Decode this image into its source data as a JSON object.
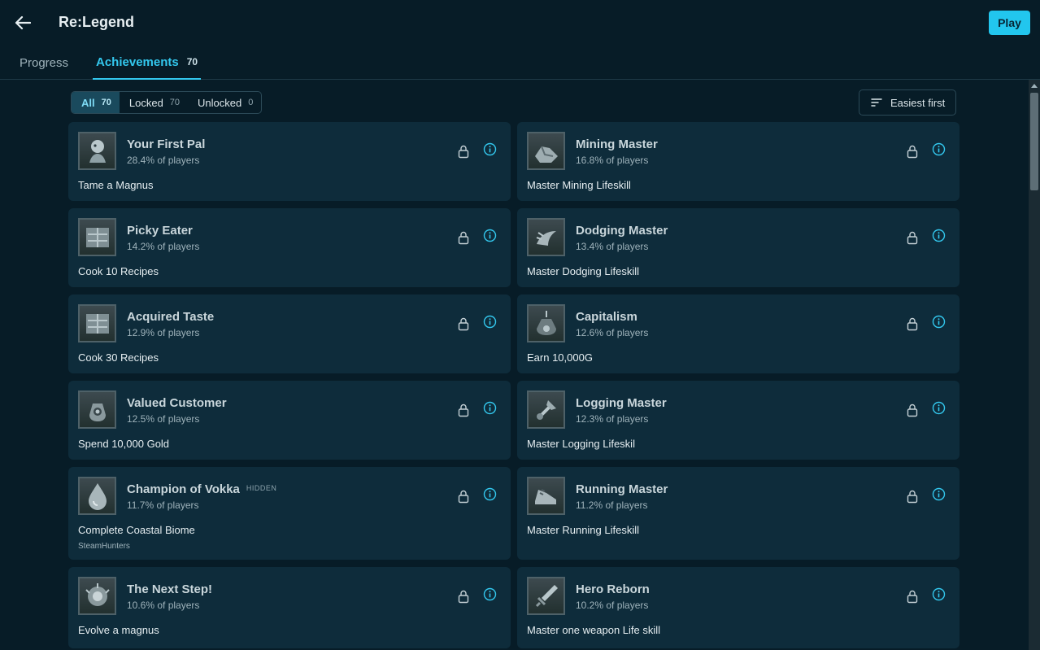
{
  "header": {
    "title": "Re:Legend",
    "play_label": "Play"
  },
  "tabs": {
    "progress_label": "Progress",
    "achievements_label": "Achievements",
    "achievements_count": "70"
  },
  "filters": {
    "all_label": "All",
    "all_count": "70",
    "locked_label": "Locked",
    "locked_count": "70",
    "unlocked_label": "Unlocked",
    "unlocked_count": "0"
  },
  "sort": {
    "label": "Easiest first"
  },
  "colors": {
    "accent": "#22c6ee",
    "background": "#071c27",
    "card": "#0e2c3b"
  },
  "achievements": [
    {
      "name": "Your First Pal",
      "percent": "28.4% of players",
      "description": "Tame a Magnus",
      "icon": "pal-icon"
    },
    {
      "name": "Mining Master",
      "percent": "16.8% of players",
      "description": "Master Mining Lifeskill",
      "icon": "ore-icon"
    },
    {
      "name": "Picky Eater",
      "percent": "14.2% of players",
      "description": "Cook 10 Recipes",
      "icon": "kitchen-icon"
    },
    {
      "name": "Dodging Master",
      "percent": "13.4% of players",
      "description": "Master Dodging Lifeskill",
      "icon": "dodge-icon"
    },
    {
      "name": "Acquired Taste",
      "percent": "12.9% of players",
      "description": "Cook 30 Recipes",
      "icon": "kitchen-icon"
    },
    {
      "name": "Capitalism",
      "percent": "12.6% of players",
      "description": "Earn 10,000G",
      "icon": "money-bag-icon"
    },
    {
      "name": "Valued Customer",
      "percent": "12.5% of players",
      "description": "Spend 10,000 Gold",
      "icon": "coin-bag-icon"
    },
    {
      "name": "Logging Master",
      "percent": "12.3% of players",
      "description": "Master Logging Lifeskil",
      "icon": "axe-icon"
    },
    {
      "name": "Champion of Vokka",
      "percent": "11.7% of players",
      "description": "Complete Coastal Biome",
      "hidden_label": "HIDDEN",
      "source": "SteamHunters",
      "icon": "water-drop-icon"
    },
    {
      "name": "Running Master",
      "percent": "11.2% of players",
      "description": "Master Running Lifeskill",
      "icon": "running-shoe-icon"
    },
    {
      "name": "The Next Step!",
      "percent": "10.6% of players",
      "description": "Evolve a magnus",
      "icon": "evolve-icon"
    },
    {
      "name": "Hero Reborn",
      "percent": "10.2% of players",
      "description": "Master one weapon Life skill",
      "icon": "sword-icon"
    }
  ]
}
